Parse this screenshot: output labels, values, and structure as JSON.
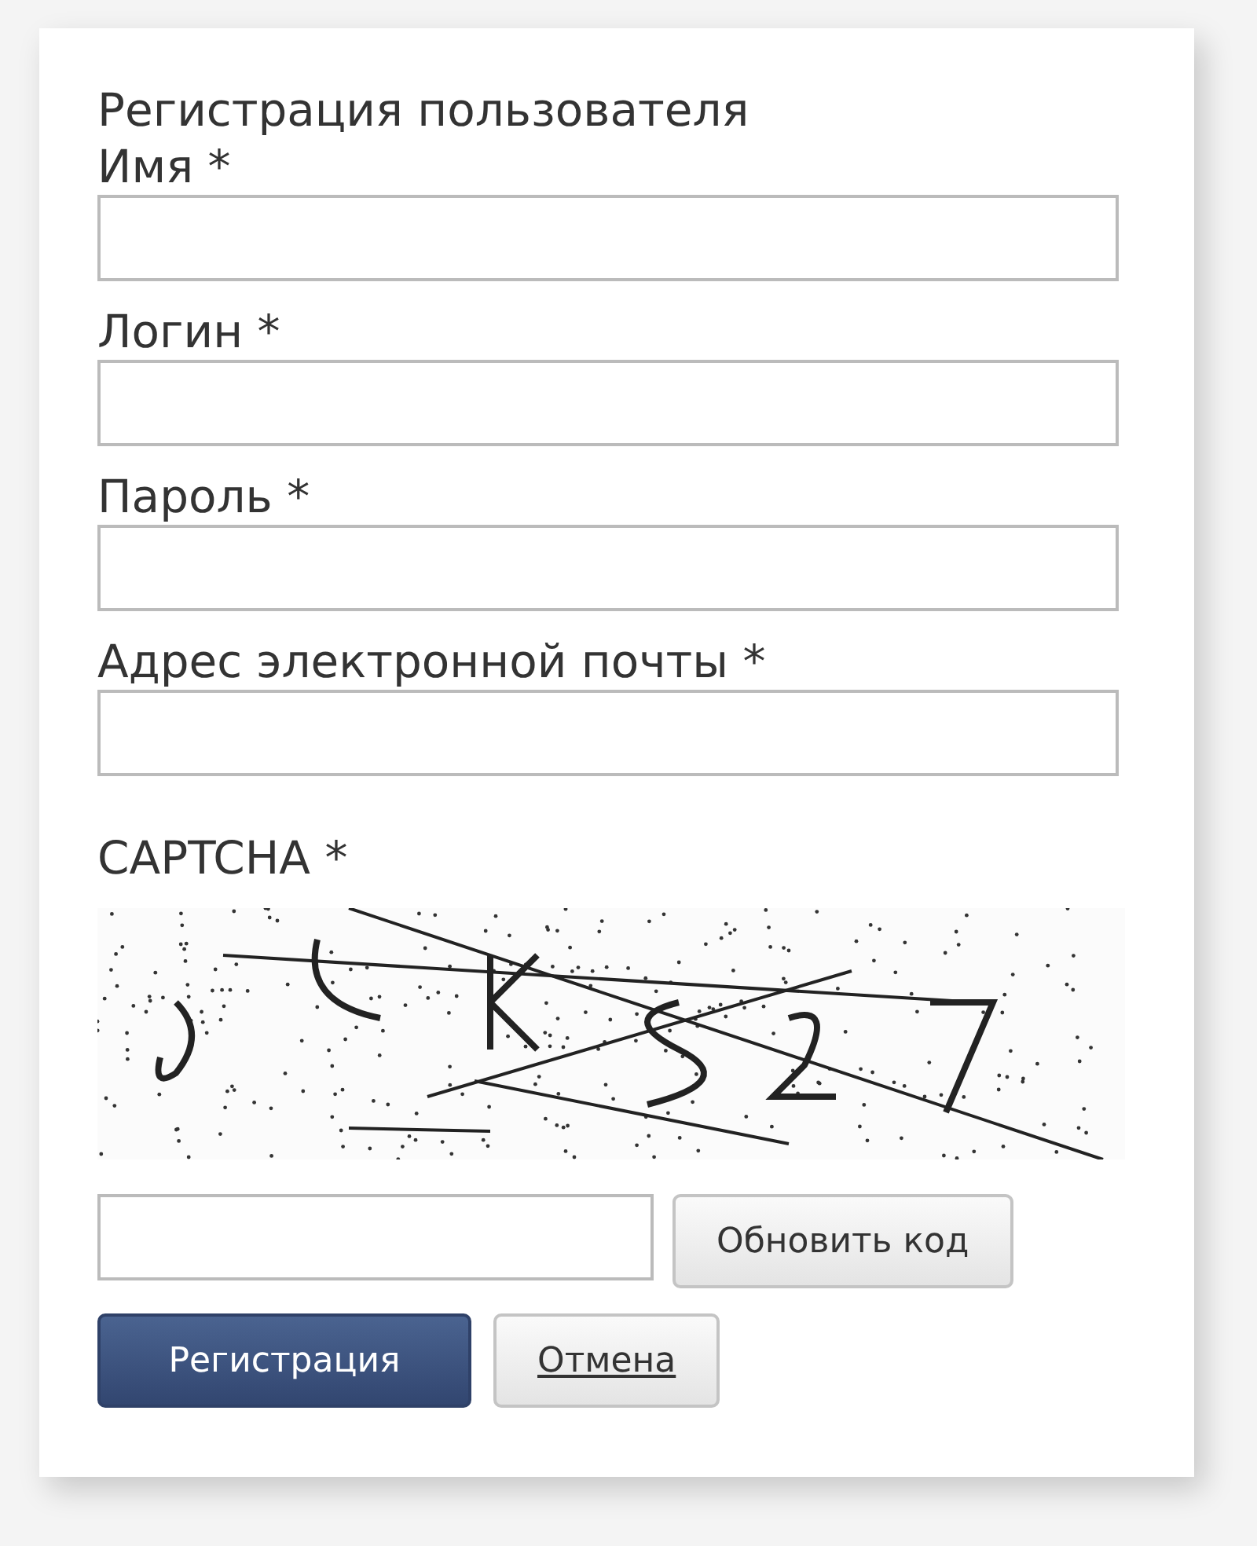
{
  "form": {
    "title": "Регистрация пользователя",
    "fields": [
      {
        "label": "Имя *"
      },
      {
        "label": "Логин *"
      },
      {
        "label": "Пароль *"
      },
      {
        "label": "Адрес электронной почты *"
      }
    ],
    "captcha": {
      "label": "CAPTCHA *",
      "kind": "picture",
      "refresh_button": "Обновить код"
    },
    "buttons": [
      {
        "label": "Регистрация",
        "kind": "primary"
      },
      {
        "label": "Отмена",
        "kind": "link"
      }
    ]
  }
}
